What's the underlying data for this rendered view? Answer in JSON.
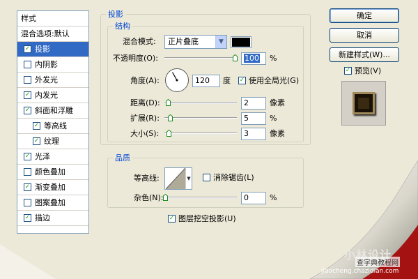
{
  "styles_panel": {
    "header": "样式",
    "blend_default": "混合选项:默认",
    "items": [
      {
        "label": "投影",
        "checked": true,
        "selected": true,
        "indent": false
      },
      {
        "label": "内阴影",
        "checked": false,
        "selected": false,
        "indent": false
      },
      {
        "label": "外发光",
        "checked": false,
        "selected": false,
        "indent": false
      },
      {
        "label": "内发光",
        "checked": true,
        "selected": false,
        "indent": false
      },
      {
        "label": "斜面和浮雕",
        "checked": true,
        "selected": false,
        "indent": false
      },
      {
        "label": "等高线",
        "checked": true,
        "selected": false,
        "indent": true
      },
      {
        "label": "纹理",
        "checked": true,
        "selected": false,
        "indent": true
      },
      {
        "label": "光泽",
        "checked": true,
        "selected": false,
        "indent": false
      },
      {
        "label": "颜色叠加",
        "checked": false,
        "selected": false,
        "indent": false
      },
      {
        "label": "渐变叠加",
        "checked": true,
        "selected": false,
        "indent": false
      },
      {
        "label": "图案叠加",
        "checked": false,
        "selected": false,
        "indent": false
      },
      {
        "label": "描边",
        "checked": true,
        "selected": false,
        "indent": false
      }
    ]
  },
  "drop_shadow": {
    "title": "投影",
    "structure": {
      "title": "结构",
      "blend_mode_label": "混合模式:",
      "blend_mode_value": "正片叠底",
      "shadow_color": "#000000",
      "opacity_label": "不透明度(O):",
      "opacity_value": "100",
      "opacity_unit": "%",
      "opacity_level": 1.0,
      "angle_label": "角度(A):",
      "angle_value": "120",
      "angle_unit": "度",
      "use_global_light_label": "使用全局光(G)",
      "use_global_light_checked": true,
      "distance_label": "距离(D):",
      "distance_value": "2",
      "distance_unit": "像素",
      "spread_label": "扩展(R):",
      "spread_value": "5",
      "spread_unit": "%",
      "size_label": "大小(S):",
      "size_value": "3",
      "size_unit": "像素"
    },
    "quality": {
      "title": "品质",
      "contour_label": "等高线:",
      "anti_aliased_label": "消除锯齿(L)",
      "anti_aliased_checked": false,
      "noise_label": "杂色(N):",
      "noise_value": "0",
      "noise_unit": "%"
    },
    "knockout_label": "图层挖空投影(U)",
    "knockout_checked": true
  },
  "buttons": {
    "ok": "确定",
    "cancel": "取消",
    "new_style": "新建样式(W)...",
    "preview_label": "预览(V)",
    "preview_checked": true
  },
  "watermark": {
    "text": "小林设计",
    "url": "jiaocheng.chazidian.com",
    "label": "查字典教程网"
  },
  "colors": {
    "accent": "#316ac5",
    "panel_bg": "#ece9d8",
    "group_title": "#0046d5",
    "curl_red": "#a41212"
  }
}
